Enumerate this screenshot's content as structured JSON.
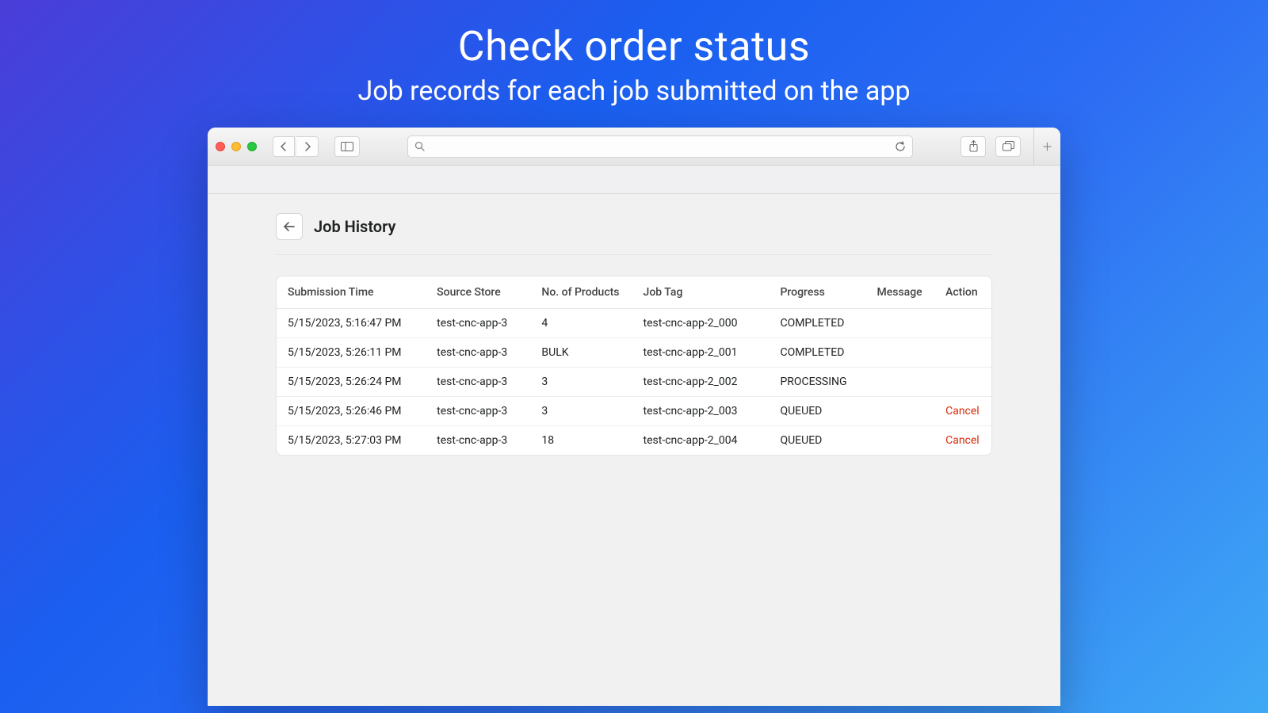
{
  "hero": {
    "title": "Check order status",
    "subtitle": "Job records for each job submitted on the app"
  },
  "browser": {
    "url_value": "",
    "url_placeholder": ""
  },
  "page": {
    "title": "Job History"
  },
  "table": {
    "headers": {
      "submission": "Submission Time",
      "source": "Source Store",
      "products": "No. of Products",
      "tag": "Job Tag",
      "progress": "Progress",
      "message": "Message",
      "action": "Action"
    },
    "rows": [
      {
        "submission": "5/15/2023, 5:16:47 PM",
        "source": "test-cnc-app-3",
        "products": "4",
        "tag": "test-cnc-app-2_000",
        "progress": "COMPLETED",
        "message": "",
        "action": ""
      },
      {
        "submission": "5/15/2023, 5:26:11 PM",
        "source": "test-cnc-app-3",
        "products": "BULK",
        "tag": "test-cnc-app-2_001",
        "progress": "COMPLETED",
        "message": "",
        "action": ""
      },
      {
        "submission": "5/15/2023, 5:26:24 PM",
        "source": "test-cnc-app-3",
        "products": "3",
        "tag": "test-cnc-app-2_002",
        "progress": "PROCESSING",
        "message": "",
        "action": ""
      },
      {
        "submission": "5/15/2023, 5:26:46 PM",
        "source": "test-cnc-app-3",
        "products": "3",
        "tag": "test-cnc-app-2_003",
        "progress": "QUEUED",
        "message": "",
        "action": "Cancel"
      },
      {
        "submission": "5/15/2023, 5:27:03 PM",
        "source": "test-cnc-app-3",
        "products": "18",
        "tag": "test-cnc-app-2_004",
        "progress": "QUEUED",
        "message": "",
        "action": "Cancel"
      }
    ]
  }
}
